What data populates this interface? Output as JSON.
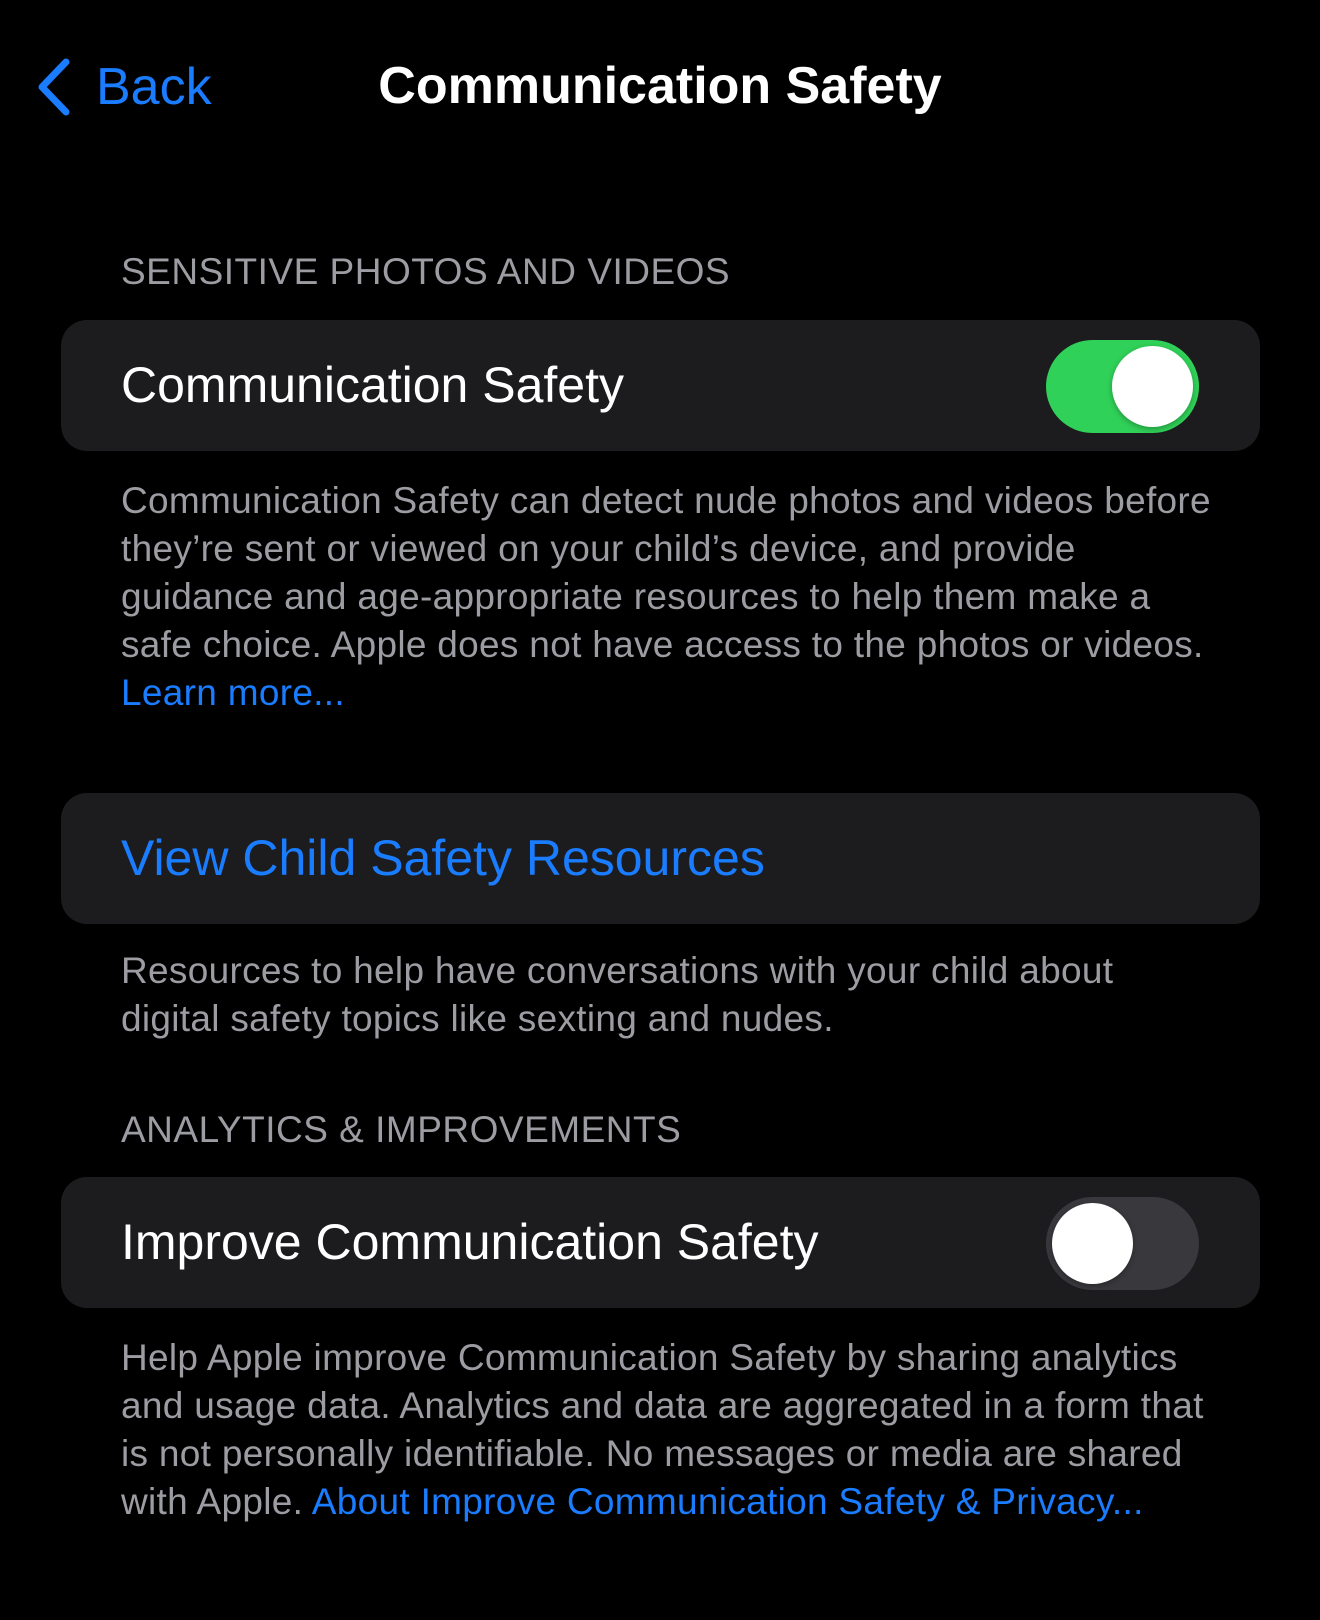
{
  "nav": {
    "back_label": "Back",
    "back_icon": "chevron-left-icon",
    "title": "Communication Safety"
  },
  "sections": {
    "sensitive": {
      "header": "SENSITIVE PHOTOS AND VIDEOS",
      "toggle_label": "Communication Safety",
      "toggle_state": "on",
      "footer_text": "Communication Safety can detect nude photos and videos before they’re sent or viewed on your child’s device, and provide guidance and age-appropriate resources to help them make a safe choice. Apple does not have access to the photos or videos. ",
      "footer_link": "Learn more..."
    },
    "resources": {
      "link_label": "View Child Safety Resources",
      "footer_text": "Resources to help have conversations with your child about digital safety topics like sexting and nudes."
    },
    "analytics": {
      "header": "ANALYTICS & IMPROVEMENTS",
      "toggle_label": "Improve Communication Safety",
      "toggle_state": "off",
      "footer_text": "Help Apple improve Communication Safety by sharing analytics and usage data. Analytics and data are aggregated in a form that is not personally identifiable. No messages or media are shared with Apple. ",
      "footer_link": "About Improve Communication Safety & Privacy..."
    }
  },
  "colors": {
    "background": "#000000",
    "card": "#1c1c1e",
    "accent_blue": "#1a7cff",
    "toggle_on": "#30d158",
    "toggle_off": "#39393d",
    "secondary_text": "#9c9ca3"
  }
}
